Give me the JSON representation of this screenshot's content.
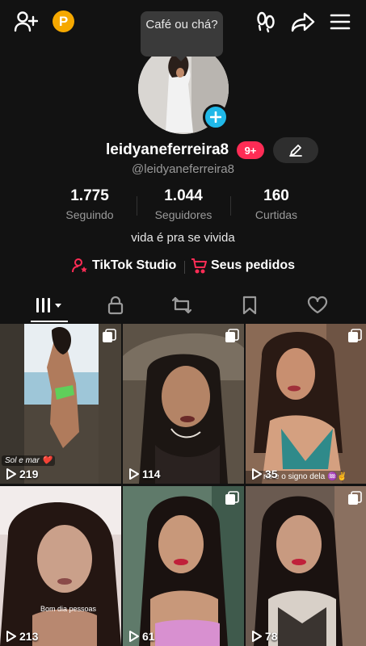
{
  "tooltip": {
    "text": "Café ou chá?"
  },
  "profile": {
    "username": "leidyaneferreira8",
    "handle": "@leidyaneferreira8",
    "notifications": "9+",
    "bio": "vida é pra se vivida",
    "coin_label": "P"
  },
  "stats": [
    {
      "value": "1.775",
      "label": "Seguindo"
    },
    {
      "value": "1.044",
      "label": "Seguidores"
    },
    {
      "value": "160",
      "label": "Curtidas"
    }
  ],
  "links": {
    "studio": "TikTok Studio",
    "orders": "Seus pedidos"
  },
  "videos": [
    {
      "views": "219",
      "caption": "Sol e mar ❤️"
    },
    {
      "views": "114",
      "caption": ""
    },
    {
      "views": "35",
      "caption": "rio e o signo dela ♒✌"
    },
    {
      "views": "213",
      "caption": "Bom dia pessoas"
    },
    {
      "views": "61",
      "caption": ""
    },
    {
      "views": "78",
      "caption": ""
    }
  ],
  "colors": {
    "accent": "#fe2c55",
    "background": "#121212",
    "coin": "#f5a800",
    "add_badge": "#20b8e8"
  }
}
